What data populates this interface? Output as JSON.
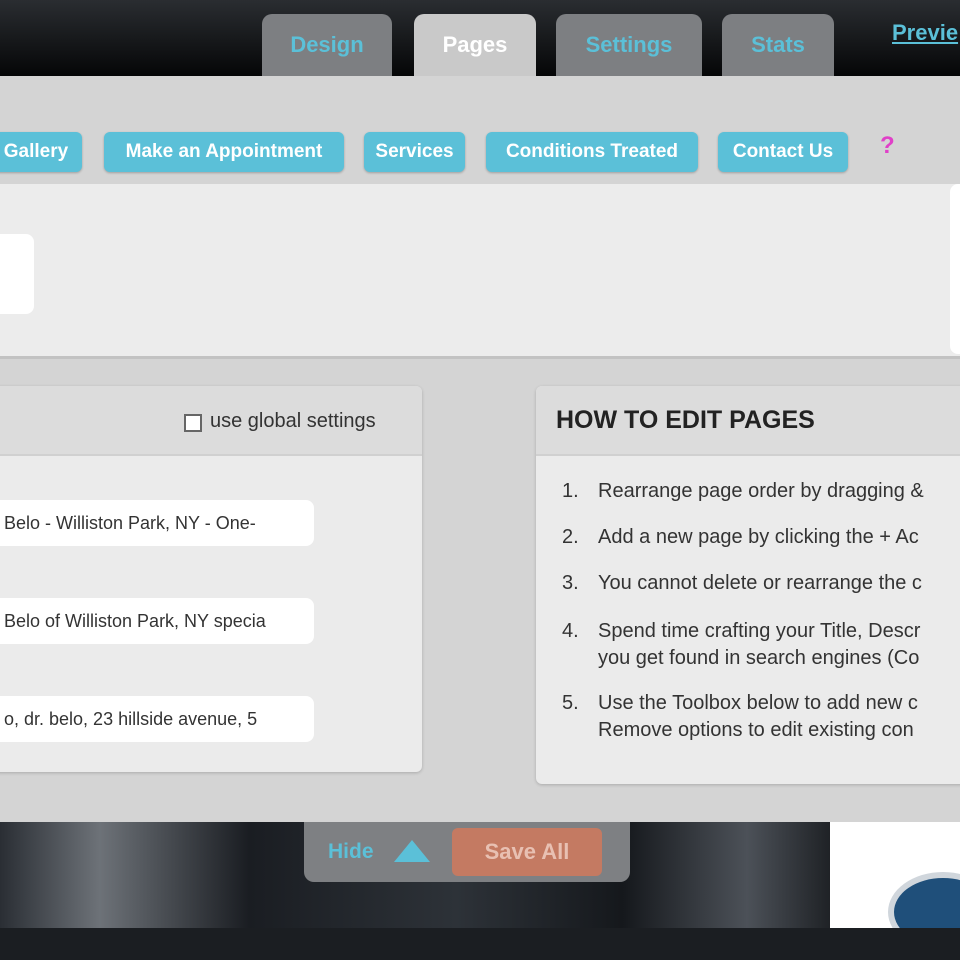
{
  "tabs": [
    {
      "label": "Design",
      "active": false
    },
    {
      "label": "Pages",
      "active": true
    },
    {
      "label": "Settings",
      "active": false
    },
    {
      "label": "Stats",
      "active": false
    }
  ],
  "preview_link": "Previe",
  "page_buttons": [
    "Gallery",
    "Make an Appointment",
    "Services",
    "Conditions Treated",
    "Contact Us"
  ],
  "help_mark": "?",
  "seo_card": {
    "global_settings_label": "use global settings",
    "global_settings_checked": false,
    "fields": [
      "Belo - Williston Park, NY - One-",
      "Belo of Williston Park, NY specia",
      "o, dr. belo, 23 hillside avenue, 5"
    ]
  },
  "howto": {
    "title": "HOW TO EDIT PAGES",
    "steps": [
      {
        "num": "1.",
        "lines": [
          "Rearrange page order by dragging &"
        ]
      },
      {
        "num": "2.",
        "lines": [
          "Add a new page by clicking the + Ac"
        ]
      },
      {
        "num": "3.",
        "lines": [
          "You cannot delete or rearrange the c"
        ]
      },
      {
        "num": "4.",
        "lines": [
          "Spend time crafting your Title, Descr",
          "you get found in search engines (Co"
        ]
      },
      {
        "num": "5.",
        "lines": [
          "Use the Toolbox below to add new c",
          "Remove options to edit existing con"
        ]
      }
    ]
  },
  "controls": {
    "hide_label": "Hide",
    "save_label": "Save All"
  },
  "colors": {
    "accent": "#5bc0d8",
    "save_button": "#c47a62",
    "help": "#e040c8"
  }
}
